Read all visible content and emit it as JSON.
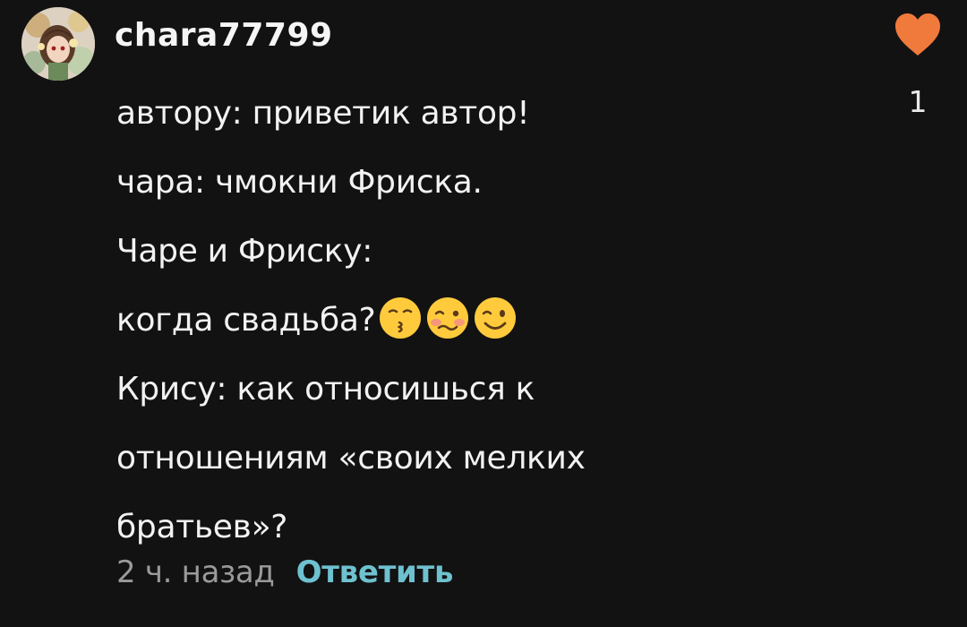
{
  "comment": {
    "username": "chara77799",
    "like_count": "1",
    "lines": [
      "автору: приветик автор!",
      "чара: чмокни Фриска.",
      "Чаре и Фриску:",
      "когда свадьба?",
      "Крису: как относишься к",
      "отношениям «своих мелких",
      "братьев»?"
    ],
    "emojis": [
      "kissing-face-emoji",
      "woozy-face-emoji",
      "winking-face-emoji"
    ],
    "time": "2 ч. назад",
    "reply_label": "Ответить"
  },
  "colors": {
    "background": "#131213",
    "text": "#f2f2f2",
    "heart": "#f07a3c",
    "reply": "#6ec1cf",
    "muted": "#9a9a9a",
    "emoji_face": "#ffcb3c"
  }
}
